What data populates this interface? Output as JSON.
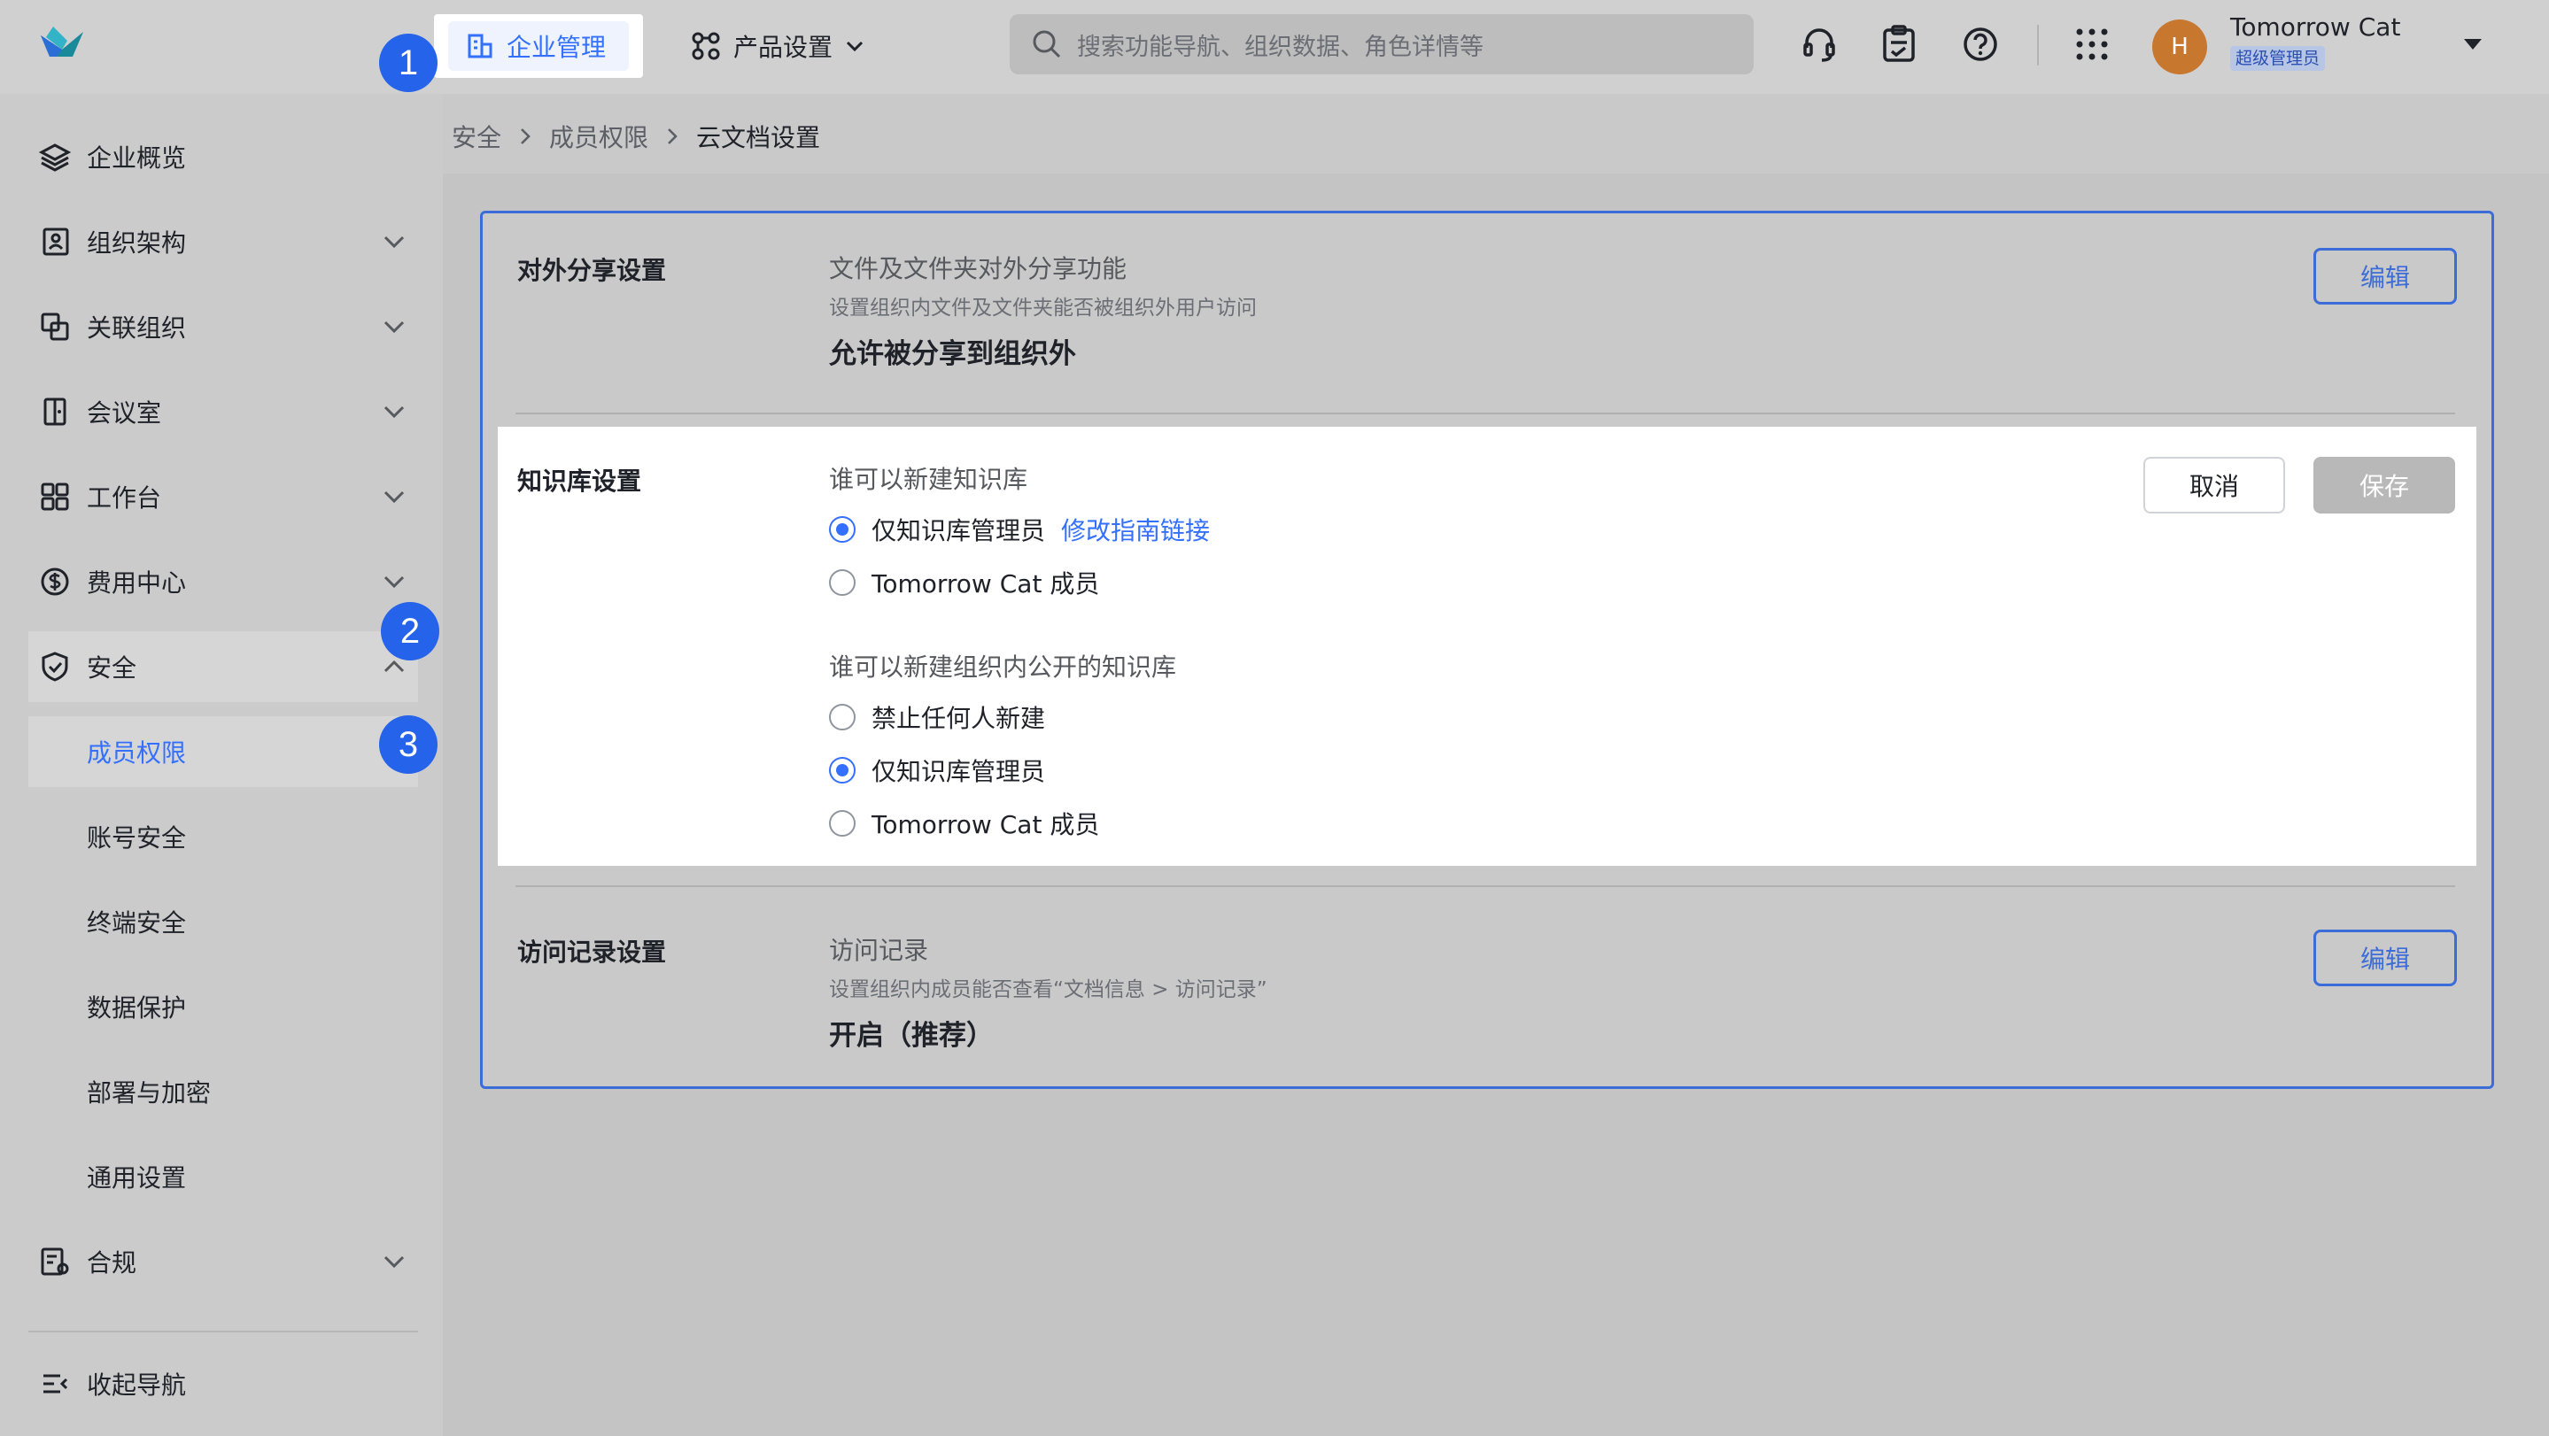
{
  "header": {
    "nav_active": "企业管理",
    "nav_product": "产品设置",
    "search_placeholder": "搜索功能导航、组织数据、角色详情等",
    "user_name": "Tomorrow Cat",
    "user_role": "超级管理员",
    "avatar_initial": "H"
  },
  "sidebar": {
    "items": [
      {
        "label": "企业概览"
      },
      {
        "label": "组织架构"
      },
      {
        "label": "关联组织"
      },
      {
        "label": "会议室"
      },
      {
        "label": "工作台"
      },
      {
        "label": "费用中心"
      },
      {
        "label": "安全"
      }
    ],
    "security_sub": [
      {
        "label": "成员权限"
      },
      {
        "label": "账号安全"
      },
      {
        "label": "终端安全"
      },
      {
        "label": "数据保护"
      },
      {
        "label": "部署与加密"
      },
      {
        "label": "通用设置"
      }
    ],
    "compliance": "合规",
    "collapse": "收起导航"
  },
  "badges": [
    "1",
    "2",
    "3"
  ],
  "breadcrumb": [
    "安全",
    "成员权限",
    "云文档设置"
  ],
  "sections": {
    "share": {
      "title": "对外分享设置",
      "subtitle": "文件及文件夹对外分享功能",
      "desc": "设置组织内文件及文件夹能否被组织外用户访问",
      "value": "允许被分享到组织外",
      "edit": "编辑"
    },
    "kb": {
      "title": "知识库设置",
      "q1": "谁可以新建知识库",
      "q1_options": [
        "仅知识库管理员",
        "Tomorrow Cat 成员"
      ],
      "q1_link": "修改指南链接",
      "q2": "谁可以新建组织内公开的知识库",
      "q2_options": [
        "禁止任何人新建",
        "仅知识库管理员",
        "Tomorrow Cat 成员"
      ],
      "cancel": "取消",
      "save": "保存"
    },
    "access": {
      "title": "访问记录设置",
      "subtitle": "访问记录",
      "desc": "设置组织内成员能否查看“文档信息 > 访问记录”",
      "value": "开启（推荐）",
      "edit": "编辑"
    }
  },
  "colors": {
    "accent": "#3370ff",
    "badge": "#2563eb",
    "card_border": "#3b6cd8",
    "avatar": "#c8772e"
  }
}
